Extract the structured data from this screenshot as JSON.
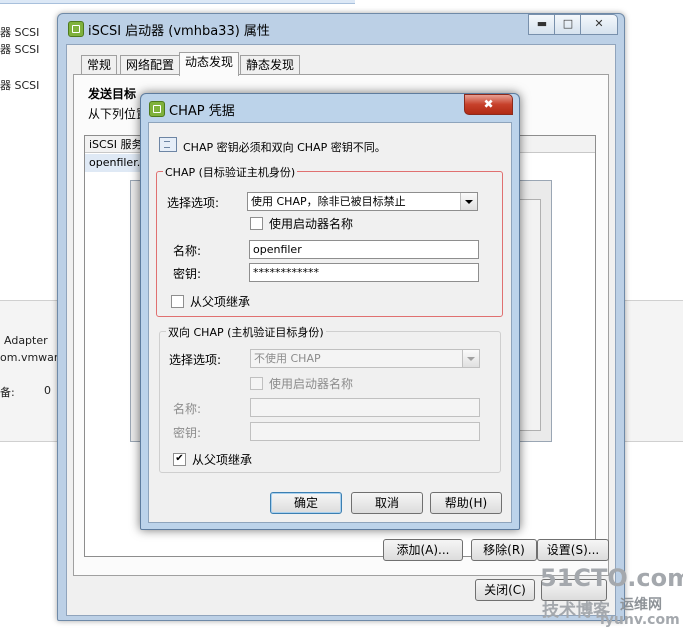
{
  "background": {
    "left_items": [
      "器 SCSI",
      "器 SCSI",
      "器 SCSI"
    ],
    "adapter_label": "Adapter",
    "vmware_label": "om.vmware:",
    "devices_label": "备:",
    "devices_value": "0"
  },
  "iscsi_window": {
    "title": "iSCSI 启动器 (vmhba33) 属性",
    "tabs": [
      "常规",
      "网络配置",
      "动态发现",
      "静态发现"
    ],
    "active_tab": "动态发现",
    "section_title": "发送目标",
    "section_desc": "从下列位置",
    "list_header": "iSCSI 服务",
    "list_row": "openfiler.",
    "add_button": "添加(A)...",
    "remove_button": "移除(R)",
    "settings_button": "设置(S)...",
    "close_button": "关闭(C)"
  },
  "chap_dialog": {
    "title": "CHAP 凭据",
    "close_glyph": "✖",
    "info_text": "CHAP 密钥必须和双向 CHAP 密钥不同。",
    "chap_group": {
      "legend": "CHAP (目标验证主机身份)",
      "select_label": "选择选项:",
      "select_value": "使用 CHAP，除非已被目标禁止",
      "use_initiator_label": "使用启动器名称",
      "use_initiator_checked": false,
      "name_label": "名称:",
      "name_value": "openfiler",
      "secret_label": "密钥:",
      "secret_value": "************",
      "inherit_label": "从父项继承",
      "inherit_checked": false
    },
    "mutual_group": {
      "legend": "双向 CHAP (主机验证目标身份)",
      "select_label": "选择选项:",
      "select_value": "不使用 CHAP",
      "use_initiator_label": "使用启动器名称",
      "name_label": "名称:",
      "secret_label": "密钥:",
      "inherit_label": "从父项继承",
      "inherit_checked": true,
      "check_glyph": "✔"
    },
    "ok_button": "确定",
    "cancel_button": "取消",
    "help_button": "帮助(H)"
  },
  "watermark": {
    "line1": "51CTO.com",
    "line2": "技术博客",
    "line3": "运维网",
    "line4": "iyunv.com"
  },
  "colors": {
    "title_bar": "#bcd0e6",
    "close_red": "#c7402a",
    "group_red": "#e07070",
    "watermark": "#9aa0a6"
  }
}
